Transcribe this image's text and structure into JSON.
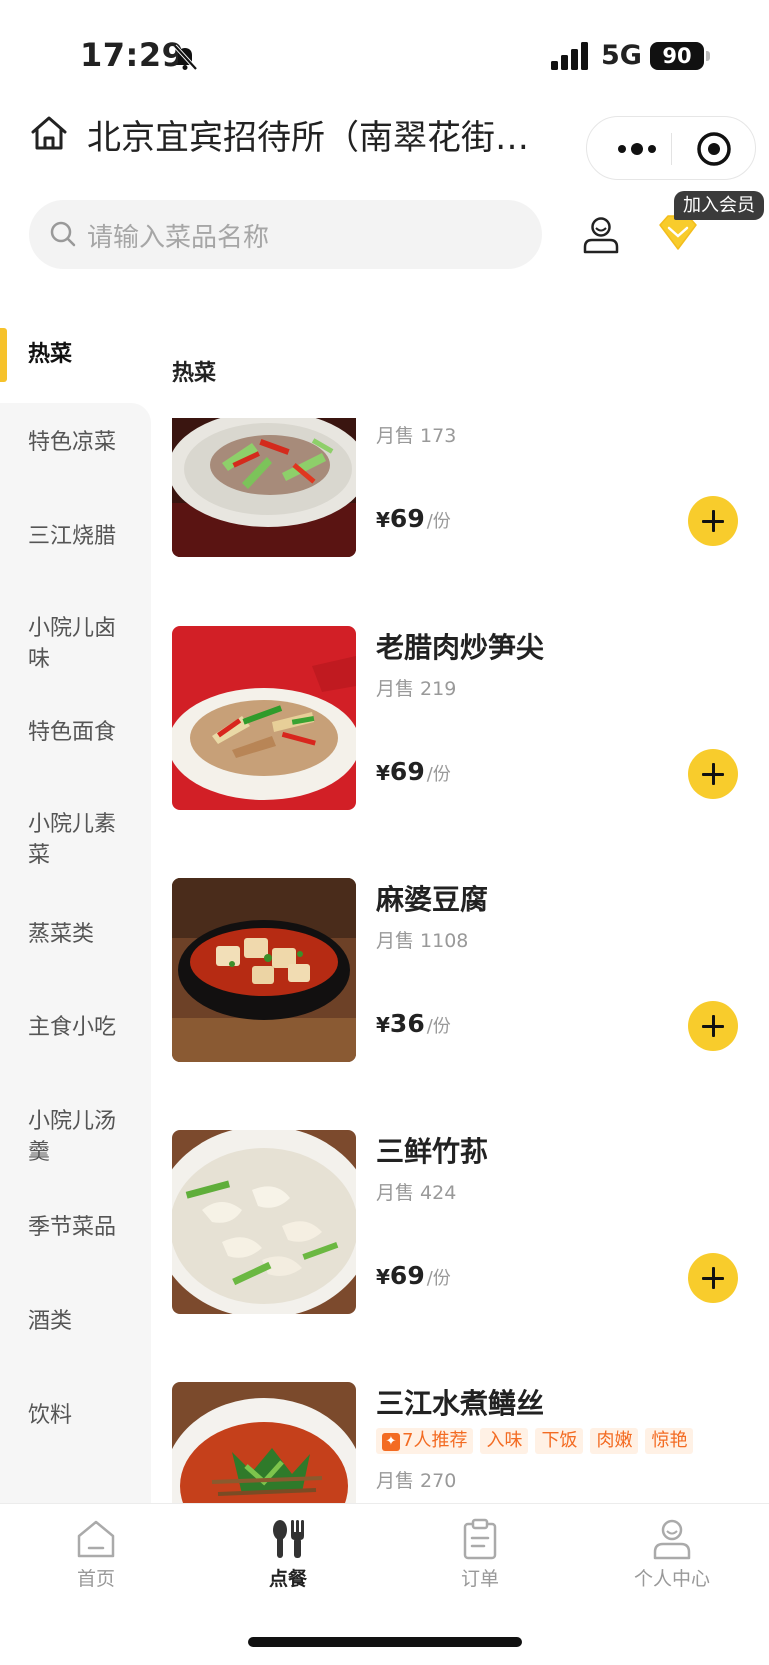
{
  "status_bar": {
    "time": "17:29",
    "network": "5G",
    "battery": "90"
  },
  "header": {
    "title": "北京宜宾招待所（南翠花街…"
  },
  "search": {
    "placeholder": "请输入菜品名称"
  },
  "member_badge": "加入会员",
  "sidebar": {
    "items": [
      {
        "label": "热菜",
        "active": true
      },
      {
        "label": "特色凉菜"
      },
      {
        "label": "三江烧腊"
      },
      {
        "label": "小院儿卤味"
      },
      {
        "label": "特色面食"
      },
      {
        "label": "小院儿素菜"
      },
      {
        "label": "蒸菜类"
      },
      {
        "label": "主食小吃"
      },
      {
        "label": "小院儿汤羹"
      },
      {
        "label": "季节菜品"
      },
      {
        "label": "酒类"
      },
      {
        "label": "饮料"
      }
    ]
  },
  "content": {
    "section_title": "热菜",
    "dishes": [
      {
        "name": "",
        "sales": "月售 173",
        "yen": "¥",
        "price": "69",
        "unit": "/份"
      },
      {
        "name": "老腊肉炒笋尖",
        "sales": "月售 219",
        "yen": "¥",
        "price": "69",
        "unit": "/份"
      },
      {
        "name": "麻婆豆腐",
        "sales": "月售 1108",
        "yen": "¥",
        "price": "36",
        "unit": "/份"
      },
      {
        "name": "三鲜竹荪",
        "sales": "月售 424",
        "yen": "¥",
        "price": "69",
        "unit": "/份"
      },
      {
        "name": "三江水煮鳝丝",
        "sales": "月售 270",
        "tags": [
          "7人推荐",
          "入味",
          "下饭",
          "肉嫩",
          "惊艳"
        ]
      }
    ]
  },
  "tabbar": {
    "items": [
      {
        "label": "首页"
      },
      {
        "label": "点餐",
        "active": true
      },
      {
        "label": "订单"
      },
      {
        "label": "个人中心"
      }
    ]
  },
  "colors": {
    "accent": "#f8cc2c",
    "tag": "#f36b22"
  }
}
